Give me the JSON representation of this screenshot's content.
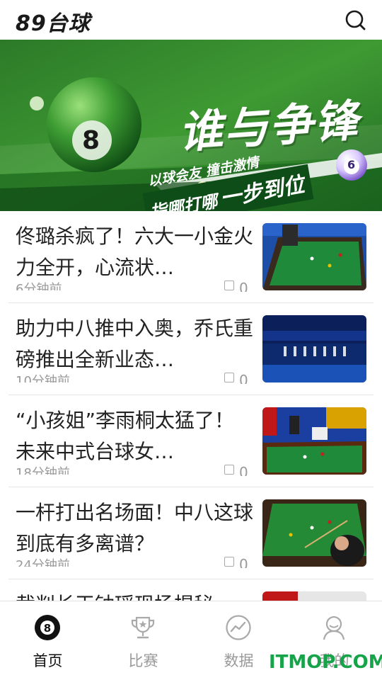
{
  "header": {
    "app_name": "89台球",
    "search_icon": "search-icon"
  },
  "banner": {
    "title": "谁与争锋",
    "slogan_line1": "以球会友 撞击激情",
    "slogan_line2_a": "指哪打哪",
    "slogan_line2_b": "一步到位",
    "ball_number_main": "8",
    "ball_number_right": "6"
  },
  "feed": {
    "items": [
      {
        "title": "佟璐杀疯了！六大一小金火力全开，心流状…",
        "time": "6分钟前",
        "comments": "0"
      },
      {
        "title": "助力中八推中入奥，乔氏重磅推出全新业态…",
        "time": "10分钟前",
        "comments": "0"
      },
      {
        "title": "“小孩姐”李雨桐太猛了！未来中式台球女…",
        "time": "18分钟前",
        "comments": "0"
      },
      {
        "title": "一杆打出名场面！中八这球到底有多离谱？",
        "time": "24分钟前",
        "comments": "0"
      },
      {
        "title": "裁判长王钟瑶现场揭秘",
        "time": "",
        "comments": ""
      }
    ]
  },
  "tabbar": {
    "tabs": [
      {
        "label": "首页",
        "icon": "eight-ball-icon",
        "active": true
      },
      {
        "label": "比赛",
        "icon": "trophy-icon",
        "active": false
      },
      {
        "label": "数据",
        "icon": "trend-chart-icon",
        "active": false
      },
      {
        "label": "我的",
        "icon": "user-icon",
        "active": false
      }
    ]
  },
  "watermark": "ITMOP.COM",
  "colors": {
    "accent_green": "#17a34a",
    "banner_green": "#2f8a2a",
    "table_green": "#1f8a3a"
  }
}
